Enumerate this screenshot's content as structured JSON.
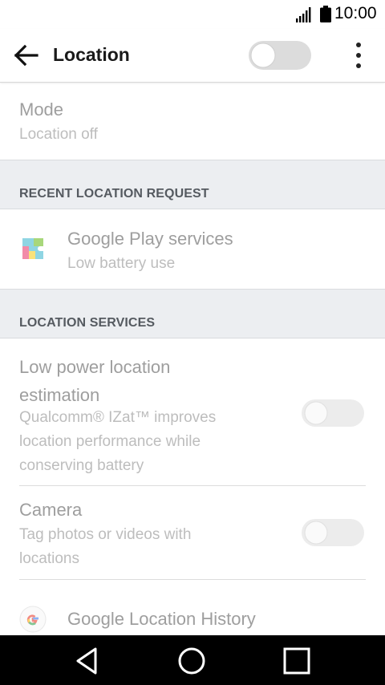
{
  "status_bar": {
    "time": "10:00"
  },
  "app_bar": {
    "title": "Location",
    "location_enabled": false
  },
  "mode": {
    "title": "Mode",
    "value": "Location off"
  },
  "recent_requests": {
    "header": "RECENT LOCATION REQUEST",
    "items": [
      {
        "title": "Google Play services",
        "subtitle": "Low battery use",
        "icon": "puzzle-icon"
      }
    ]
  },
  "location_services": {
    "header": "LOCATION SERVICES",
    "low_power": {
      "title": "Low power location estimation",
      "description": "Qualcomm® IZat™ improves location performance while conserving battery",
      "enabled": false
    },
    "camera": {
      "title": "Camera",
      "description": "Tag photos or videos with locations",
      "enabled": false
    },
    "history": {
      "title": "Google Location History",
      "icon": "google-g-icon"
    }
  },
  "nav_bar": {
    "buttons": [
      "back-icon",
      "home-icon",
      "recents-icon"
    ]
  },
  "colors": {
    "accent_off_track": "#dcdcdc",
    "disabled_track": "#ececec",
    "section_header_bg": "#eceef1",
    "nav_bar_bg": "#000000"
  }
}
